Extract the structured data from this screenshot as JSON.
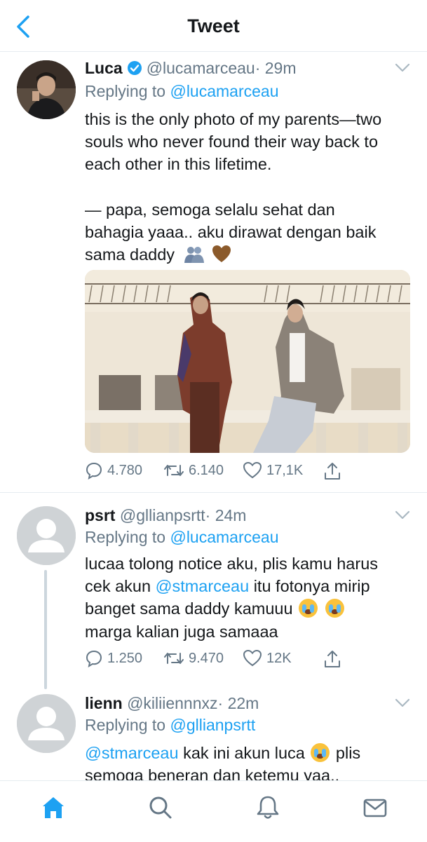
{
  "header": {
    "title": "Tweet"
  },
  "tweets": [
    {
      "name": "Luca",
      "handle": "@lucamarceau",
      "time": "· 29m",
      "replying_prefix": "Replying to ",
      "replying_to": "@lucamarceau",
      "body_lines": [
        "this is the only photo of my parents—two",
        "souls who never found their way back to",
        "each other in this lifetime.",
        "— papa, semoga selalu sehat dan",
        "bahagia yaaa.. aku dirawat dengan baik",
        "sama daddy"
      ],
      "replies": "4.780",
      "retweets": "6.140",
      "likes": "17,1K"
    },
    {
      "name": "psrt",
      "handle": "@gllianpsrtt",
      "time": "· 24m",
      "replying_prefix": "Replying to ",
      "replying_to": "@lucamarceau",
      "body_line1": "lucaa tolong notice aku, plis kamu harus",
      "body_line2_a": "cek akun ",
      "body_line2_mention": "@stmarceau",
      "body_line2_b": " itu fotonya mirip",
      "body_line3": "banget sama daddy kamuuu",
      "body_line4": "marga kalian juga samaaa",
      "replies": "1.250",
      "retweets": "9.470",
      "likes": "12K"
    },
    {
      "name": "lienn",
      "handle": "@kiliiennnxz",
      "time": "· 22m",
      "replying_prefix": "Replying to ",
      "replying_to": "@gllianpsrtt",
      "body_mention": "@stmarceau",
      "body_line1_a": " kak ini akun luca",
      "body_line1_b": " plis",
      "body_line2": "semoga beneran dan ketemu yaa.."
    }
  ],
  "icons": {
    "back": "back-chevron-icon",
    "verified": "verified-badge-icon",
    "more": "chevron-down-icon",
    "reply": "reply-icon",
    "retweet": "retweet-icon",
    "like": "heart-icon",
    "share": "share-icon",
    "tabs": [
      "home-icon",
      "search-icon",
      "notifications-icon",
      "messages-icon"
    ]
  },
  "colors": {
    "accent": "#1da1f2",
    "muted": "#657786",
    "text": "#14171a",
    "divider": "#e6ecf0"
  }
}
